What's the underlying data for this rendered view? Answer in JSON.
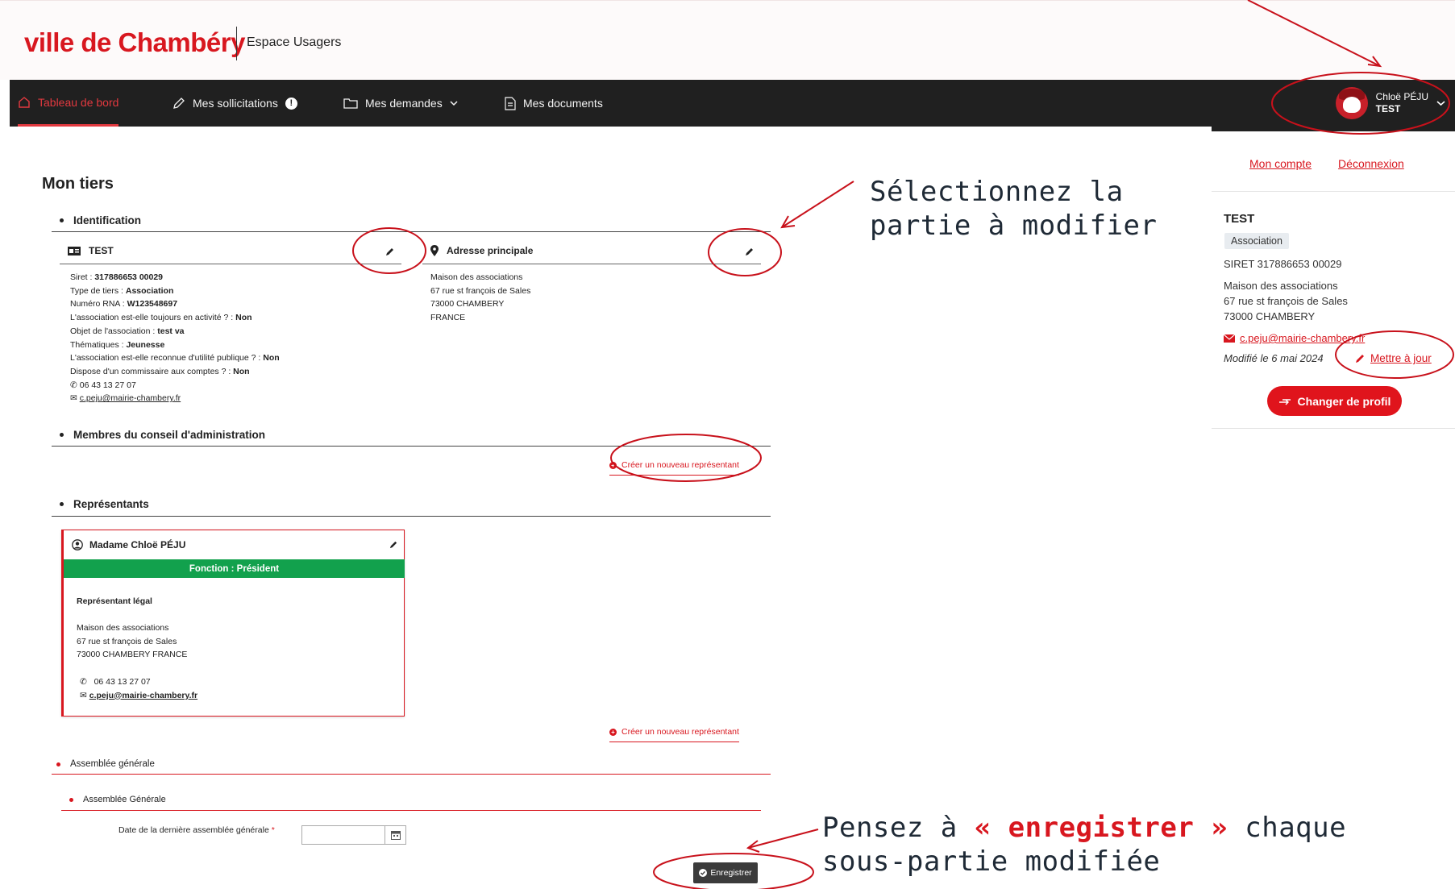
{
  "header": {
    "logo": "ville de Chambéry",
    "subtitle": "Espace Usagers"
  },
  "nav": {
    "items": [
      {
        "label": "Tableau de bord",
        "icon": "home-icon"
      },
      {
        "label": "Mes sollicitations",
        "icon": "pencil-icon",
        "badge": "!"
      },
      {
        "label": "Mes demandes",
        "icon": "folder-icon"
      },
      {
        "label": "Mes documents",
        "icon": "document-icon"
      }
    ],
    "user": {
      "first_line": "Chloë PÉJU",
      "second_line": "TEST"
    }
  },
  "side": {
    "account_link": "Mon compte",
    "logout_link": "Déconnexion",
    "name": "TEST",
    "tag": "Association",
    "siret": "SIRET 317886653 00029",
    "address": [
      "Maison des associations",
      "67 rue st françois de Sales",
      "73000 CHAMBERY"
    ],
    "email": "c.peju@mairie-chambery.fr",
    "modified": "Modifié le 6 mai 2024",
    "update_link": "Mettre à jour",
    "switch_button": "Changer de profil"
  },
  "main": {
    "title": "Mon tiers",
    "identification": {
      "heading": "Identification",
      "card_title": "TEST",
      "address_title": "Adresse principale",
      "fields": [
        {
          "label": "Siret : ",
          "value": "317886653 00029"
        },
        {
          "label": "Type de tiers : ",
          "value": "Association"
        },
        {
          "label": "Numéro RNA : ",
          "value": "W123548697"
        },
        {
          "label": "L'association est-elle toujours en activité ? : ",
          "value": "Non"
        },
        {
          "label": "Objet de l'association : ",
          "value": "test va"
        },
        {
          "label": "Thématiques : ",
          "value": "Jeunesse"
        },
        {
          "label": "L'association est-elle reconnue d'utilité publique ? : ",
          "value": "Non"
        },
        {
          "label": "Dispose d'un commissaire aux comptes ? : ",
          "value": "Non"
        }
      ],
      "phone": "06 43 13 27 07",
      "email": "c.peju@mairie-chambery.fr",
      "address": [
        "Maison des associations",
        "67 rue st françois de Sales",
        "73000 CHAMBERY",
        "FRANCE"
      ]
    },
    "board": {
      "heading": "Membres du conseil d'administration",
      "create_link": "Créer un nouveau représentant"
    },
    "representatives": {
      "heading": "Représentants",
      "card": {
        "name": "Madame Chloë PÉJU",
        "function": "Fonction : Président",
        "role": "Représentant légal",
        "address": [
          "Maison des associations",
          "67 rue st françois de Sales",
          "73000 CHAMBERY FRANCE"
        ],
        "phone": "06 43 13 27 07",
        "email": "c.peju@mairie-chambery.fr"
      },
      "create_link": "Créer un nouveau représentant"
    },
    "assembly": {
      "heading": "Assemblée générale",
      "subheading": "Assemblée Générale",
      "date_label": "Date de la dernière assemblée générale",
      "required_mark": "*",
      "date_value": "",
      "save_button": "Enregistrer"
    }
  },
  "annotations": {
    "select_part": [
      "Sélectionnez la",
      "partie à modifier"
    ],
    "save_prefix": "Pensez à ",
    "save_highlight": "« enregistrer »",
    "save_suffix": " chaque",
    "save_line2": "sous-partie modifiée",
    "color": "#d8171f"
  },
  "colors": {
    "brand": "#d8171f",
    "nav_bg": "#202020",
    "function_band": "#12a14d"
  }
}
